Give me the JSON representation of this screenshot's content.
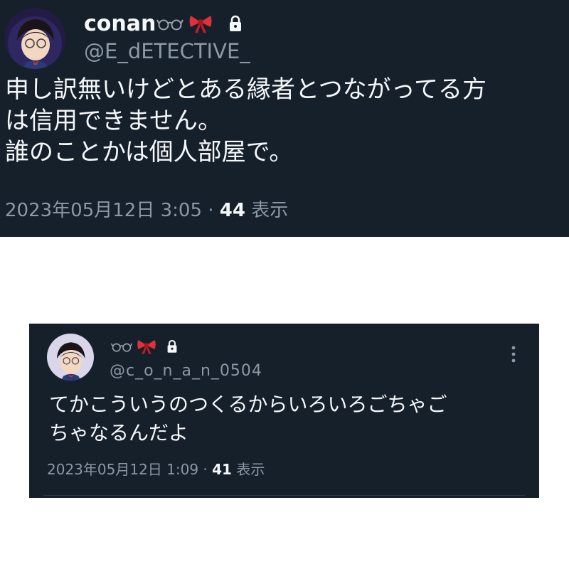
{
  "tweet1": {
    "display_name": "conan",
    "handle": "@E_dETECTIVE_",
    "text_lines": [
      "申し訳無いけどとある縁者とつながってる方",
      "は信用できません。",
      "誰のことかは個人部屋で。"
    ],
    "date": "2023年05月12日 3:05 · ",
    "views": "44",
    "views_label": " 表示"
  },
  "tweet2": {
    "display_name": "",
    "handle": "@c_o_n_a_n_0504",
    "text_lines": [
      "てかこういうのつくるからいろいろごちゃご",
      "ちゃなるんだよ"
    ],
    "date": "2023年05月12日 1:09 · ",
    "views": "41",
    "views_label": " 表示"
  },
  "icons": [
    "glasses-icon",
    "bow-icon",
    "lock-icon",
    "more-icon",
    "avatar"
  ],
  "colors": {
    "card_background": "#16202b",
    "text_primary": "#f5f8fa",
    "text_secondary": "#8b98a5",
    "bow_red": "#e0303c"
  }
}
